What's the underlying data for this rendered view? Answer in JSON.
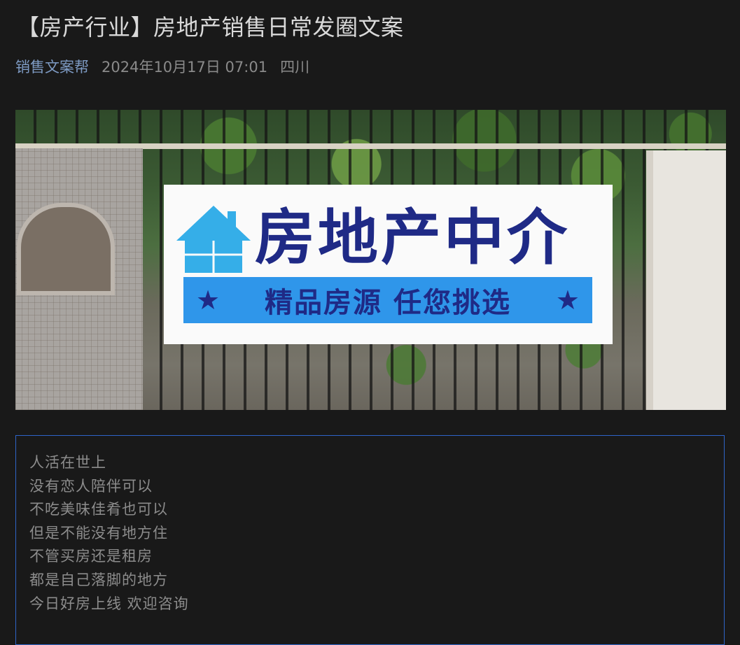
{
  "article": {
    "title": "【房产行业】房地产销售日常发圈文案",
    "author": "销售文案帮",
    "date": "2024年10月17日 07:01",
    "location": "四川"
  },
  "hero_image": {
    "banner_main": "房地产中介",
    "banner_slogan": "精品房源  任您挑选",
    "star_left": "★",
    "star_right": "★",
    "colors": {
      "banner_text": "#1f2a86",
      "strip": "#2f96ea",
      "house": "#35aee8"
    }
  },
  "content": {
    "lines": [
      "人活在世上",
      "没有恋人陪伴可以",
      "不吃美味佳肴也可以",
      "但是不能没有地方住",
      "不管买房还是租房",
      "都是自己落脚的地方",
      "今日好房上线 欢迎咨询"
    ],
    "border_color": "#2f64c8"
  }
}
